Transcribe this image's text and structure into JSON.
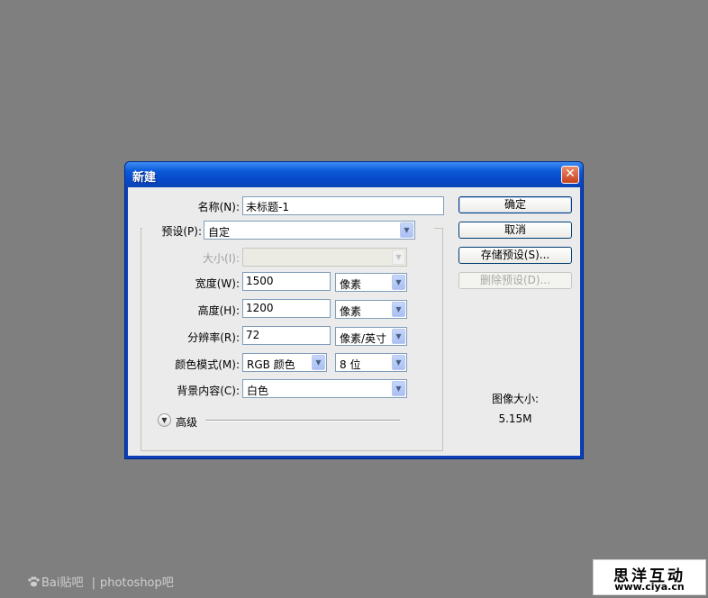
{
  "dialog": {
    "title": "新建",
    "close_symbol": "✕",
    "name_label": "名称(N):",
    "name_value": "未标题-1",
    "preset_label": "预设(P):",
    "preset_value": "自定",
    "size_label": "大小(I):",
    "size_value": "",
    "width_label": "宽度(W):",
    "width_value": "1500",
    "width_unit": "像素",
    "height_label": "高度(H):",
    "height_value": "1200",
    "height_unit": "像素",
    "resolution_label": "分辨率(R):",
    "resolution_value": "72",
    "resolution_unit": "像素/英寸",
    "color_mode_label": "颜色模式(M):",
    "color_mode_value": "RGB 颜色",
    "bit_depth_value": "8 位",
    "background_label": "背景内容(C):",
    "background_value": "白色",
    "advanced_label": "高级",
    "ok_button": "确定",
    "cancel_button": "取消",
    "save_preset_button": "存储预设(S)...",
    "delete_preset_button": "删除预设(D)...",
    "image_size_label": "图像大小:",
    "image_size_value": "5.15M"
  },
  "watermarks": {
    "left_brand": "Bai",
    "left_brand_suffix": "贴吧",
    "left_separator": "|",
    "left_forum": "photoshop吧",
    "right_title": "思洋互动",
    "right_url": "www.ciya.cn"
  },
  "colors": {
    "background": "#7f7f7f",
    "titlebar": "#0d5ad8",
    "client": "#ebebeb",
    "close": "#c93f1e"
  }
}
